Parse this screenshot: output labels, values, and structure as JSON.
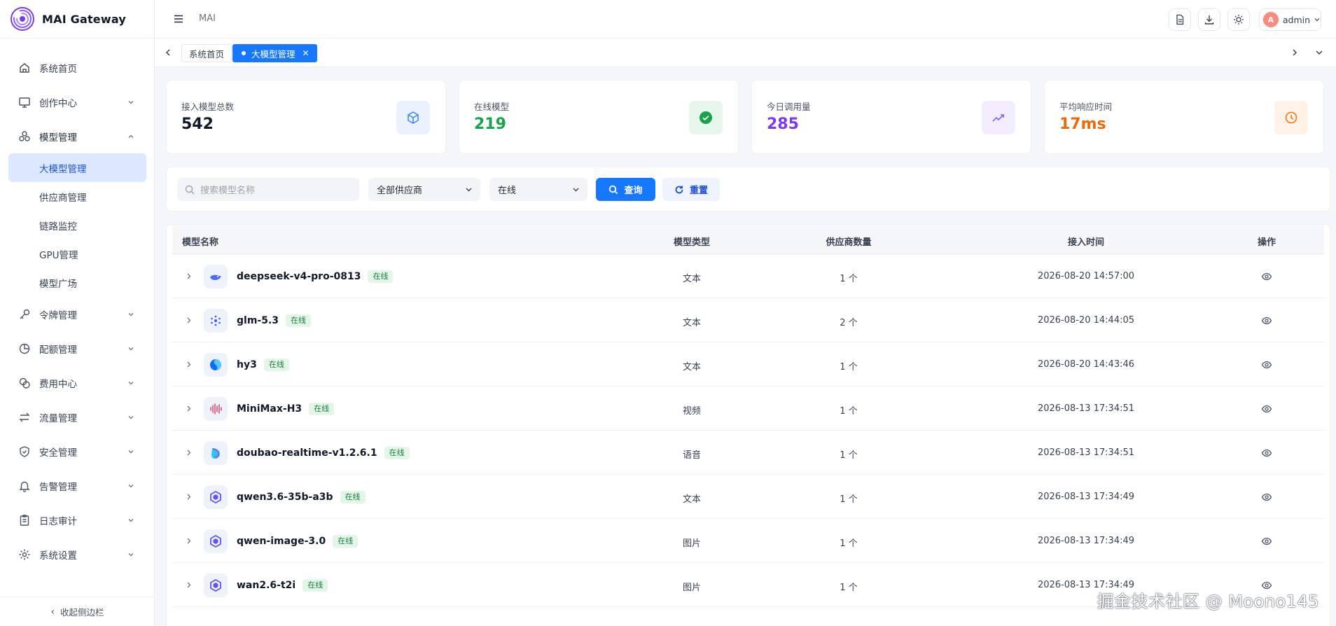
{
  "app": {
    "title": "MAI Gateway",
    "breadcrumb": "MAI"
  },
  "sidebar": {
    "items": [
      {
        "label": "系统首页",
        "icon": "home-icon"
      },
      {
        "label": "创作中心",
        "icon": "monitor-icon",
        "expandable": true
      },
      {
        "label": "模型管理",
        "icon": "cubes-icon",
        "expandable": true,
        "open": true,
        "children": [
          "大模型管理",
          "供应商管理",
          "链路监控",
          "GPU管理",
          "模型广场"
        ]
      },
      {
        "label": "令牌管理",
        "icon": "key-icon",
        "expandable": true
      },
      {
        "label": "配额管理",
        "icon": "pie-chart-icon",
        "expandable": true
      },
      {
        "label": "费用中心",
        "icon": "coins-icon",
        "expandable": true
      },
      {
        "label": "流量管理",
        "icon": "arrows-swap-icon",
        "expandable": true
      },
      {
        "label": "安全管理",
        "icon": "shield-check-icon",
        "expandable": true
      },
      {
        "label": "告警管理",
        "icon": "bell-icon",
        "expandable": true
      },
      {
        "label": "日志审计",
        "icon": "clipboard-icon",
        "expandable": true
      },
      {
        "label": "系统设置",
        "icon": "gear-icon",
        "expandable": true
      }
    ],
    "active_child": "大模型管理",
    "collapse_label": "收起侧边栏"
  },
  "header": {
    "user": "admin",
    "avatar_letter": "A"
  },
  "tabs": [
    {
      "label": "系统首页",
      "active": false
    },
    {
      "label": "大模型管理",
      "active": true
    }
  ],
  "stats": [
    {
      "label": "接入模型总数",
      "value": "542",
      "color": "#111827",
      "icon": "cube-icon",
      "icon_bg": "#eaf2ff",
      "icon_color": "#3b82f6"
    },
    {
      "label": "在线模型",
      "value": "219",
      "color": "#16a34a",
      "icon": "check-circle-icon",
      "icon_bg": "#e7f7ec",
      "icon_color": "#16a34a"
    },
    {
      "label": "今日调用量",
      "value": "285",
      "color": "#7c3aed",
      "icon": "trend-icon",
      "icon_bg": "#f3eefe",
      "icon_color": "#8b5cf6"
    },
    {
      "label": "平均响应时间",
      "value": "17ms",
      "color": "#ea6a0c",
      "icon": "clock-icon",
      "icon_bg": "#fff3e8",
      "icon_color": "#f97316"
    }
  ],
  "filters": {
    "search_placeholder": "搜索模型名称",
    "provider": "全部供应商",
    "status": "在线",
    "query_label": "查询",
    "reset_label": "重置"
  },
  "table": {
    "headers": {
      "name": "模型名称",
      "type": "模型类型",
      "count": "供应商数量",
      "time": "接入时间",
      "op": "操作"
    },
    "rows": [
      {
        "name": "deepseek-v4-pro-0813",
        "status": "在线",
        "type": "文本",
        "count": "1 个",
        "time": "2026-08-20 14:57:00",
        "icon": "whale-icon"
      },
      {
        "name": "glm-5.3",
        "status": "在线",
        "type": "文本",
        "count": "2 个",
        "time": "2026-08-20 14:44:05",
        "icon": "glm-icon"
      },
      {
        "name": "hy3",
        "status": "在线",
        "type": "文本",
        "count": "1 个",
        "time": "2026-08-20 14:43:46",
        "icon": "hunyuan-icon"
      },
      {
        "name": "MiniMax-H3",
        "status": "在线",
        "type": "视频",
        "count": "1 个",
        "time": "2026-08-13 17:34:51",
        "icon": "waveform-icon"
      },
      {
        "name": "doubao-realtime-v1.2.6.1",
        "status": "在线",
        "type": "语音",
        "count": "1 个",
        "time": "2026-08-13 17:34:51",
        "icon": "doubao-icon"
      },
      {
        "name": "qwen3.6-35b-a3b",
        "status": "在线",
        "type": "文本",
        "count": "1 个",
        "time": "2026-08-13 17:34:49",
        "icon": "qwen-icon"
      },
      {
        "name": "qwen-image-3.0",
        "status": "在线",
        "type": "图片",
        "count": "1 个",
        "time": "2026-08-13 17:34:49",
        "icon": "qwen-icon"
      },
      {
        "name": "wan2.6-t2i",
        "status": "在线",
        "type": "图片",
        "count": "1 个",
        "time": "2026-08-13 17:34:49",
        "icon": "qwen-icon"
      }
    ]
  },
  "watermark": "掘金技术社区 @ Moono145"
}
